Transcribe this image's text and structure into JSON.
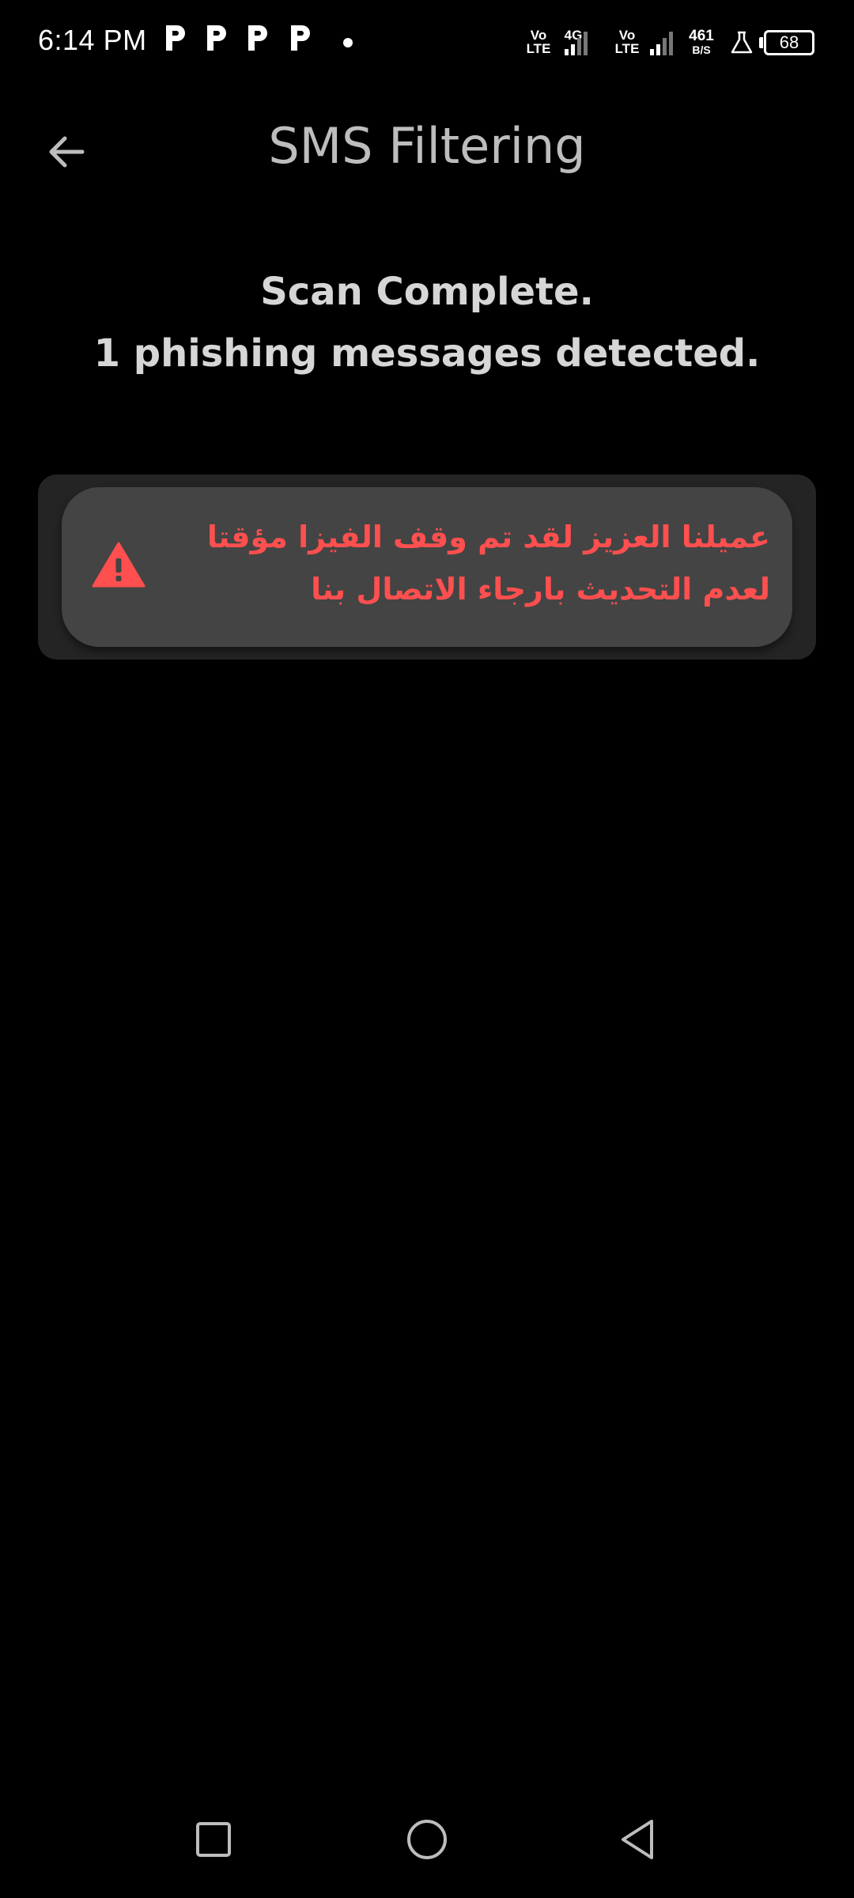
{
  "status_bar": {
    "time": "6:14 PM",
    "notification_icons": [
      "p-app-icon",
      "p-app-icon",
      "p-app-icon",
      "p-app-icon"
    ],
    "net1": {
      "top": "Vo",
      "bottom": "LTE"
    },
    "net2": {
      "label": "4G"
    },
    "net3": {
      "top": "Vo",
      "bottom": "LTE"
    },
    "speed": {
      "value": "461",
      "unit": "B/S"
    },
    "battery": "68"
  },
  "app_bar": {
    "title": "SMS Filtering",
    "back_icon": "arrow-left-icon"
  },
  "scan": {
    "line1": "Scan Complete.",
    "line2": "1 phishing messages detected."
  },
  "messages": [
    {
      "icon": "warning-icon",
      "text": "عميلنا العزيز لقد تم وقف الفيزا مؤقتا لعدم التحديث بارجاء الاتصال بنا"
    }
  ],
  "nav_bar": {
    "buttons": [
      "recents-square-icon",
      "home-circle-icon",
      "back-triangle-icon"
    ]
  },
  "colors": {
    "background": "#000000",
    "title": "#bdbdbd",
    "card": "#444444",
    "panel": "#242424",
    "danger": "#ff4f4f"
  }
}
